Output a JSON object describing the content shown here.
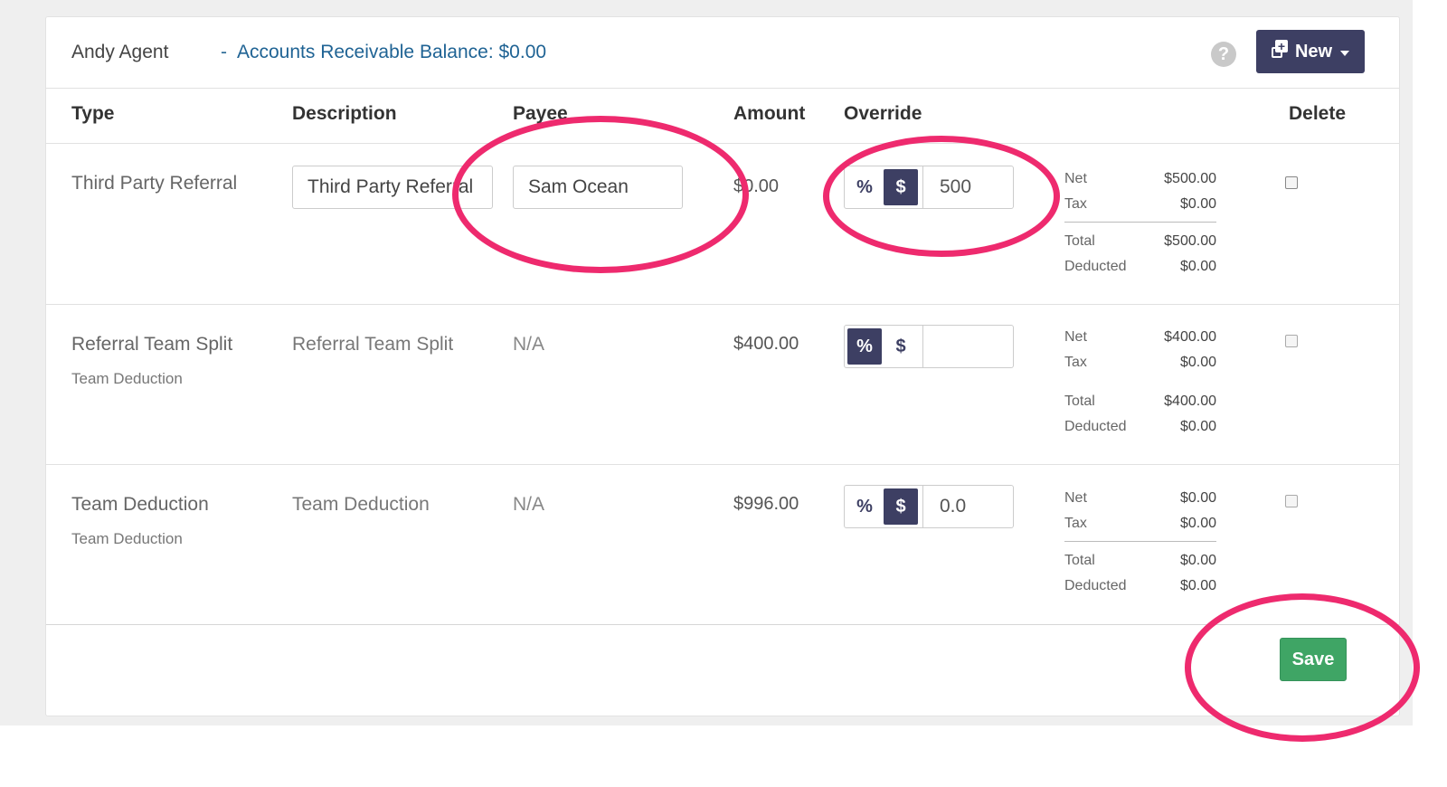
{
  "header": {
    "agent_name": "Andy Agent",
    "separator": "-",
    "balance_label": "Accounts Receivable Balance: $0.00",
    "help_glyph": "?",
    "new_button_label": "New"
  },
  "columns": {
    "type": "Type",
    "description": "Description",
    "payee": "Payee",
    "amount": "Amount",
    "override": "Override",
    "delete": "Delete"
  },
  "toggle": {
    "percent": "%",
    "dollar": "$"
  },
  "rows": [
    {
      "type": "Third Party Referral",
      "description_value": "Third Party Referral",
      "payee_value": "Sam Ocean",
      "amount": "$0.00",
      "override_mode": "$",
      "override_value": "500",
      "summary": {
        "net_label": "Net",
        "net": "$500.00",
        "tax_label": "Tax",
        "tax": "$0.00",
        "total_label": "Total",
        "total": "$500.00",
        "deducted_label": "Deducted",
        "deducted": "$0.00"
      }
    },
    {
      "type": "Referral Team Split",
      "subtype": "Team Deduction",
      "description": "Referral Team Split",
      "payee": "N/A",
      "amount": "$400.00",
      "override_mode": "%",
      "override_value": "",
      "summary": {
        "net_label": "Net",
        "net": "$400.00",
        "tax_label": "Tax",
        "tax": "$0.00",
        "total_label": "Total",
        "total": "$400.00",
        "deducted_label": "Deducted",
        "deducted": "$0.00"
      }
    },
    {
      "type": "Team Deduction",
      "subtype": "Team Deduction",
      "description": "Team Deduction",
      "payee": "N/A",
      "amount": "$996.00",
      "override_mode": "$",
      "override_value": "0.0",
      "summary": {
        "net_label": "Net",
        "net": "$0.00",
        "tax_label": "Tax",
        "tax": "$0.00",
        "total_label": "Total",
        "total": "$0.00",
        "deducted_label": "Deducted",
        "deducted": "$0.00"
      }
    }
  ],
  "footer": {
    "save_label": "Save"
  },
  "colors": {
    "brand_navy": "#3d3f63",
    "link_blue": "#1f6394",
    "save_green": "#3fa565",
    "annotation_pink": "#ee2a6e"
  }
}
